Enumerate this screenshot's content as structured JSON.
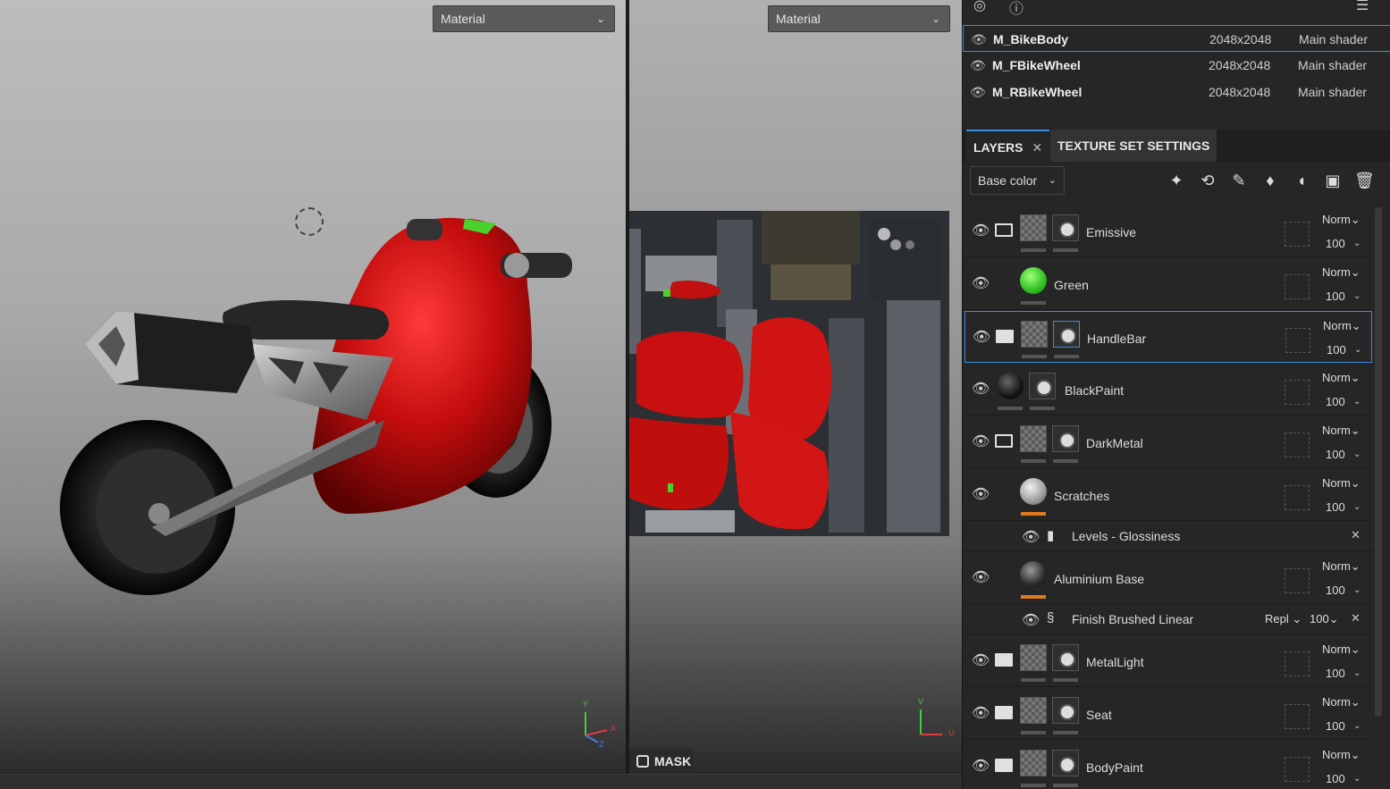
{
  "viewport3d": {
    "dropdown": "Material",
    "gizmo": [
      "Y",
      "X",
      "Z"
    ]
  },
  "viewport2d": {
    "dropdown": "Material",
    "gizmo": [
      "V",
      "U"
    ],
    "mask_label": "MASK"
  },
  "texture_sets": [
    {
      "name": "M_BikeBody",
      "resolution": "2048x2048",
      "shader": "Main shader",
      "selected": true
    },
    {
      "name": "M_FBikeWheel",
      "resolution": "2048x2048",
      "shader": "Main shader",
      "selected": false
    },
    {
      "name": "M_RBikeWheel",
      "resolution": "2048x2048",
      "shader": "Main shader",
      "selected": false
    }
  ],
  "tabs": {
    "layers": "LAYERS",
    "texture_set_settings": "TEXTURE SET SETTINGS"
  },
  "toolbar": {
    "channel": "Base color",
    "icons": [
      "magic-wand-icon",
      "smart-fill-icon",
      "brush-icon",
      "fill-bucket-icon",
      "mask-icon",
      "folder-icon",
      "trash-icon"
    ]
  },
  "layers": [
    {
      "name": "Emissive",
      "blend": "Norm",
      "opacity": "100",
      "type": "folder-open"
    },
    {
      "name": "Green",
      "blend": "Norm",
      "opacity": "100",
      "type": "fill-green"
    },
    {
      "name": "HandleBar",
      "blend": "Norm",
      "opacity": "100",
      "type": "folder",
      "selected": true
    },
    {
      "name": "BlackPaint",
      "blend": "Norm",
      "opacity": "100",
      "type": "fill-black"
    },
    {
      "name": "DarkMetal",
      "blend": "Norm",
      "opacity": "100",
      "type": "folder-open"
    },
    {
      "name": "Scratches",
      "blend": "Norm",
      "opacity": "100",
      "type": "fill-silver",
      "effect": {
        "name": "Levels - Glossiness",
        "icon": "levels-icon"
      }
    },
    {
      "name": "Aluminium Base",
      "blend": "Norm",
      "opacity": "100",
      "type": "fill-dark",
      "effect": {
        "name": "Finish Brushed Linear",
        "icon": "substance-icon",
        "blend": "Repl",
        "opacity": "100"
      }
    },
    {
      "name": "MetalLight",
      "blend": "Norm",
      "opacity": "100",
      "type": "folder"
    },
    {
      "name": "Seat",
      "blend": "Norm",
      "opacity": "100",
      "type": "folder"
    },
    {
      "name": "BodyPaint",
      "blend": "Norm",
      "opacity": "100",
      "type": "folder"
    }
  ]
}
